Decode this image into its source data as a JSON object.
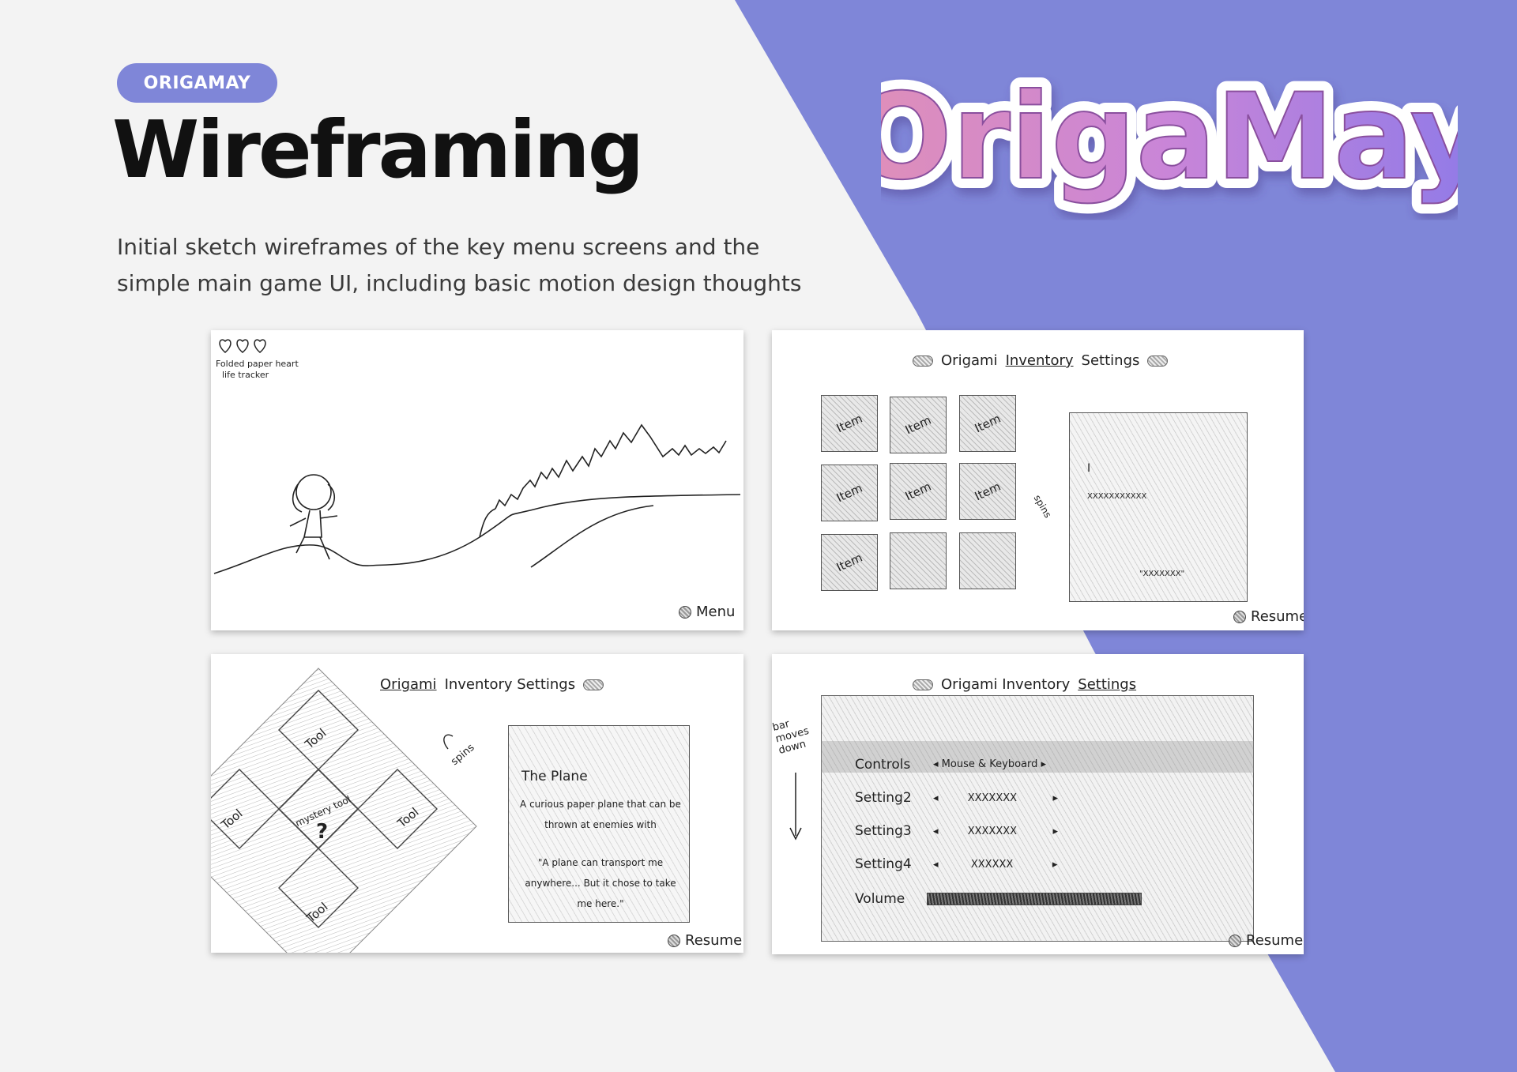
{
  "header": {
    "tag": "ORIGAMAY",
    "title": "Wireframing",
    "subtitle": "Initial sketch wireframes of the key menu screens and the simple main game UI, including basic motion design thoughts"
  },
  "logo": {
    "text": "OrigaMay"
  },
  "colors": {
    "accent": "#7f86d8",
    "background": "#f3f3f3",
    "logo_pink": "#d98ab8",
    "logo_purple": "#9b7ee8"
  },
  "wireframes": {
    "game": {
      "heart_note": "Folded paper heart",
      "heart_note2": "life tracker",
      "menu_button": "Menu",
      "icons": [
        "heart-icon",
        "heart-icon",
        "heart-icon"
      ]
    },
    "inventory": {
      "title_prefix": "Origami",
      "title_underlined": "Inventory",
      "title_suffix": "Settings",
      "items": [
        "Item",
        "Item",
        "Item",
        "Item",
        "Item",
        "Item",
        "Item",
        "",
        ""
      ],
      "spins_note": "spins",
      "panel_mark": "I",
      "panel_line": "XXXXXXXXXXX",
      "panel_quote": "\"XXXXXXX\"",
      "resume_button": "Resume"
    },
    "origami": {
      "title_underlined": "Origami",
      "title_rest": "Inventory Settings",
      "tools": [
        "Tool",
        "Tool",
        "Tool",
        "Tool"
      ],
      "center_label": "mystery tool",
      "center_mark": "?",
      "spins_note": "spins",
      "item_name": "The Plane",
      "item_desc": "A curious paper plane that can be thrown at enemies with",
      "item_quote": "\"A plane can transport me anywhere... But it chose to take me here.\"",
      "resume_button": "Resume"
    },
    "settings": {
      "title_prefix": "Origami Inventory",
      "title_underlined": "Settings",
      "note": "bar moves down",
      "rows": [
        {
          "label": "Controls",
          "value": "Mouse & Keyboard"
        },
        {
          "label": "Setting2",
          "value": "XXXXXXX"
        },
        {
          "label": "Setting3",
          "value": "XXXXXXX"
        },
        {
          "label": "Setting4",
          "value": "XXXXXX"
        },
        {
          "label": "Volume",
          "value": ""
        }
      ],
      "resume_button": "Resume"
    }
  }
}
